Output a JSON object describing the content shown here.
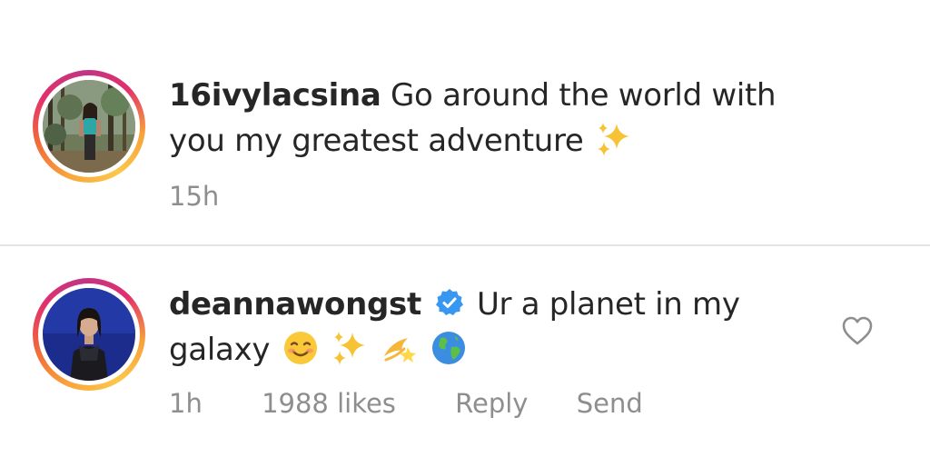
{
  "caption": {
    "username": "16ivylacsina",
    "text_line1": "Go around the world with",
    "text_line2": "you my greatest adventure",
    "emojis": [
      "sparkles"
    ],
    "timestamp": "15h"
  },
  "comment": {
    "username": "deannawongst",
    "verified": true,
    "text_line1": "Ur a planet in my",
    "text_line2": "galaxy",
    "emojis": [
      "smiling-face",
      "sparkles",
      "dizzy",
      "globe"
    ],
    "timestamp": "1h",
    "likes": "1988 likes",
    "reply_label": "Reply",
    "send_label": "Send",
    "liked": false
  },
  "colors": {
    "text_primary": "#262626",
    "text_secondary": "#8e8e8e",
    "verified_blue": "#3897f0",
    "divider": "#e3e3e3",
    "story_ring": [
      "#fcc74b",
      "#f26b3a",
      "#e1306c",
      "#c13584"
    ]
  }
}
